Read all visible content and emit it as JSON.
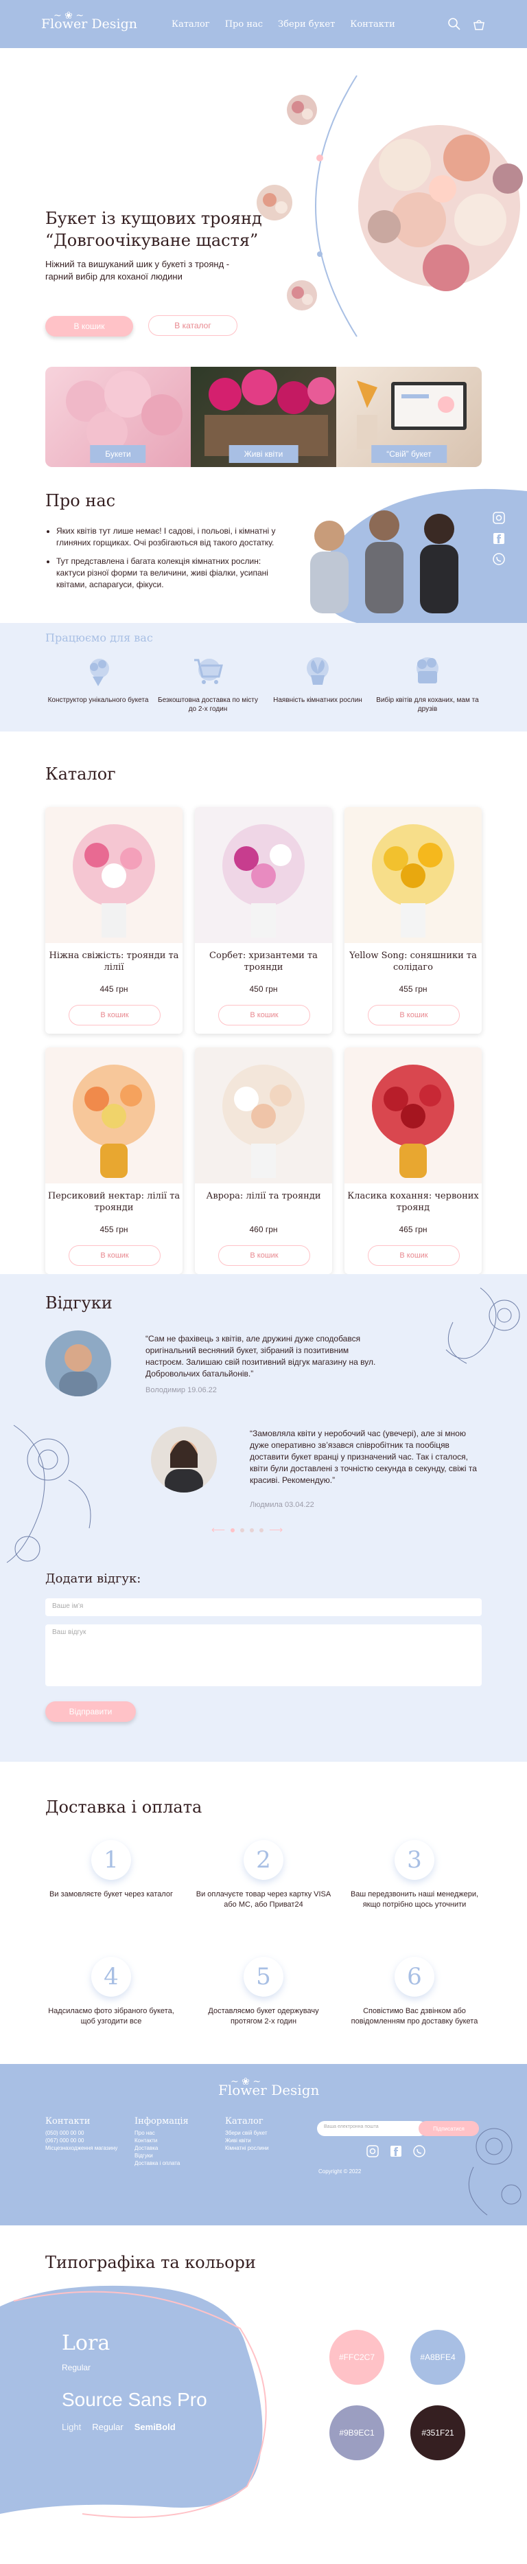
{
  "header": {
    "logo": "Flower Design",
    "nav": [
      "Каталог",
      "Про нас",
      "Збери букет",
      "Контакти"
    ]
  },
  "hero": {
    "title": "Букет із кущових троянд “Довгоочікуване щастя”",
    "text": "Ніжний та вишуканий шик у букеті з троянд - гарний вибір для коханої людини",
    "btn_cart": "В кошик",
    "btn_catalog": "В каталог"
  },
  "categories": [
    "Букети",
    "Живі квіти",
    "“Свій” букет"
  ],
  "about": {
    "title": "Про нас",
    "p1": "Яких квітів тут лише немає! І садові, і польові, і кімнатні у глиняних горщиках. Очі розбігаються від такого достатку.",
    "p2": "Тут представлена і багата колекція кімнатних рослин: кактуси різної форми та величини, живі фіалки, усипані квітами, аспарагуси, фікуси.",
    "advantages_title": "Працюємо для вас",
    "advantages": [
      "Конструктор унікального букета",
      "Безкоштовна доставка по місту до 2-х годин",
      "Наявність кімнатних рослин",
      "Вибір квітів для коханих, мам та друзів"
    ]
  },
  "catalog": {
    "title": "Каталог",
    "btn": "В кошик",
    "items": [
      {
        "name": "Ніжна свіжість: троянди та лілії",
        "price": "445 грн"
      },
      {
        "name": "Сорбет: хризантеми та троянди",
        "price": "450 грн"
      },
      {
        "name": "Yellow Song: соняшники та солідаго",
        "price": "455 грн"
      },
      {
        "name": "Персиковий нектар: лілії та троянди",
        "price": "455 грн"
      },
      {
        "name": "Аврора: лілії та троянди",
        "price": "460 грн"
      },
      {
        "name": "Класика кохання: червоних троянд",
        "price": "465 грн"
      }
    ]
  },
  "reviews": {
    "title": "Відгуки",
    "items": [
      {
        "text": "“Сам не фахівець з квітів, але дружині дуже сподобався оригінальний весняний букет, зібраний із позитивним настроєм. Залишаю свій позитивний відгук магазину на вул. Добровольчих батальйонів.”",
        "author": "Володимир 19.06.22"
      },
      {
        "text": "“Замовляла квіти у неробочий час (увечері), але зі мною дуже оперативно зв’язався співробітник та пообіцяв доставити букет вранці у призначений час. Так і сталося, квіти були доставлені з точністю секунда в секунду, свіжі та красиві. Рекомендую.”",
        "author": "Людмила 03.04.22"
      }
    ],
    "form_title": "Додати відгук:",
    "name_placeholder": "Ваше ім’я",
    "review_placeholder": "Ваш відгук",
    "submit": "Відправити"
  },
  "delivery": {
    "title": "Доставка і оплата",
    "steps": [
      {
        "n": "1",
        "text": "Ви замовляєте букет через каталог"
      },
      {
        "n": "2",
        "text": "Ви оплачуєте товар через картку VISA або MC, або Приват24"
      },
      {
        "n": "3",
        "text": "Ваш передзвонить наші менеджери, якщо потрібно щось уточнити"
      },
      {
        "n": "4",
        "text": "Надсилаємо фото зібраного букета, щоб узгодити все"
      },
      {
        "n": "5",
        "text": "Доставляємо букет одержувачу протягом 2-х годин"
      },
      {
        "n": "6",
        "text": "Сповістимо Вас дзвінком або повідомленням про доставку букета"
      }
    ]
  },
  "footer": {
    "logo": "Flower Design",
    "contacts_title": "Контакти",
    "contacts": [
      "(050) 000 00 00",
      "(067) 000 00 00",
      "Місцезнаходження магазину"
    ],
    "info_title": "Інформація",
    "info": [
      "Про нас",
      "Контакти",
      "Доставка",
      "Відгуки",
      "Доставка і оплата"
    ],
    "catalog_title": "Каталог",
    "catalog": [
      "Збери свій букет",
      "Живі квіти",
      "Кімнатні рослини"
    ],
    "email_placeholder": "Ваша електронна пошта",
    "subscribe": "Підписатися",
    "copyright": "Copyright © 2022"
  },
  "typography": {
    "title": "Типографіка та кольори",
    "font1": "Lora",
    "font1_style": "Regular",
    "font2": "Source Sans Pro",
    "font2_styles": [
      "Light",
      "Regular",
      "SemiBold"
    ],
    "colors": [
      "#FFC2C7",
      "#A8BFE4",
      "#9B9EC1",
      "#351F21"
    ]
  }
}
